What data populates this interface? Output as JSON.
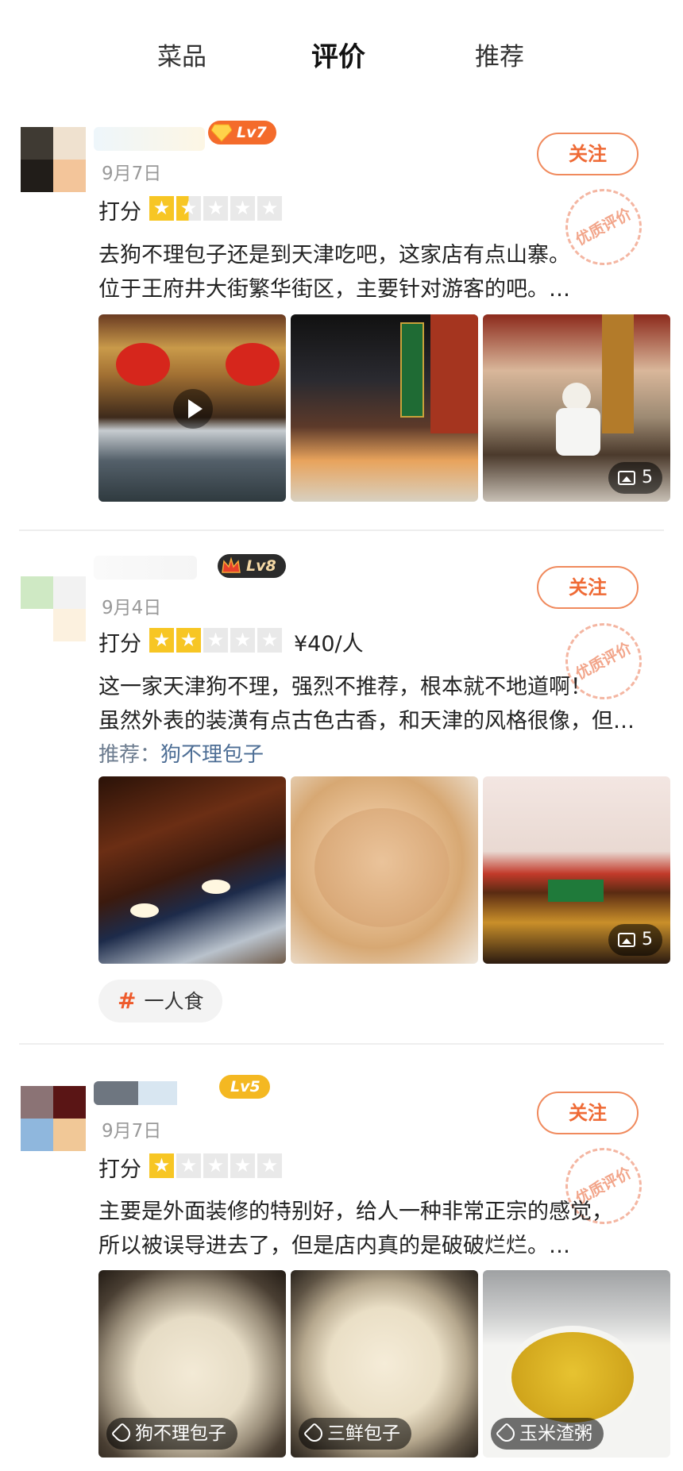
{
  "tabs": [
    {
      "label": "菜品"
    },
    {
      "label": "评价"
    },
    {
      "label": "推荐"
    }
  ],
  "colors": {
    "accent": "#ff6a2f",
    "star": "#f7c624",
    "follow": "#ef6a35"
  },
  "reviews": [
    {
      "level": "Lv7",
      "date": "9月7日",
      "follow": "关注",
      "stamp": "优质评价",
      "score_label": "打分",
      "stars": 1.5,
      "text": [
        "去狗不理包子还是到天津吃吧，这家店有点山寨。",
        "位于王府井大街繁华街区，主要针对游客的吧。…"
      ],
      "photo_count": "5"
    },
    {
      "level": "Lv8",
      "date": "9月4日",
      "follow": "关注",
      "stamp": "优质评价",
      "score_label": "打分",
      "stars": 2,
      "price": "¥40/人",
      "text": [
        "这一家天津狗不理，强烈不推荐，根本就不地道啊！",
        "虽然外表的装潢有点古色古香，和天津的风格很像，但…"
      ],
      "recommend_label": "推荐：",
      "recommend_value": "狗不理包子",
      "photo_count": "5",
      "topic": "一人食"
    },
    {
      "level": "Lv5",
      "date": "9月7日",
      "follow": "关注",
      "stamp": "优质评价",
      "score_label": "打分",
      "stars": 1,
      "text": [
        "主要是外面装修的特别好，给人一种非常正宗的感觉，",
        "所以被误导进去了，但是店内真的是破破烂烂。…"
      ],
      "dish_tags": [
        "狗不理包子",
        "三鲜包子",
        "玉米渣粥"
      ]
    }
  ]
}
